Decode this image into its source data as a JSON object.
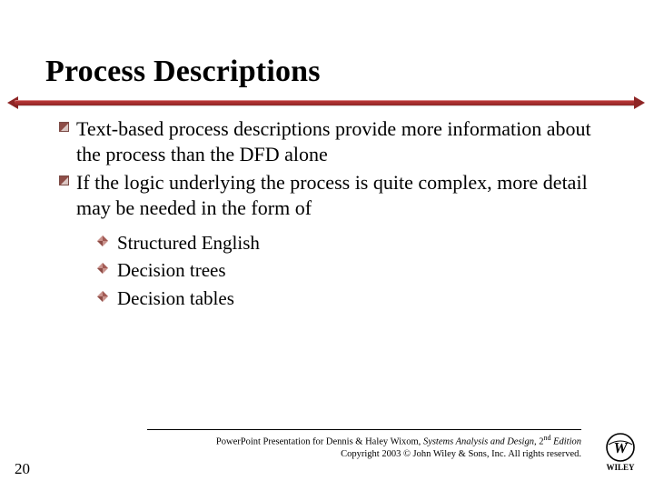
{
  "slide": {
    "title": "Process Descriptions",
    "bullets_level1": [
      "Text-based process descriptions provide more information about the process than the DFD alone",
      "If the logic underlying the process is quite complex, more detail may be needed in the form of"
    ],
    "bullets_level2": [
      "Structured English",
      "Decision trees",
      "Decision tables"
    ],
    "footer": {
      "line1_prefix": "PowerPoint Presentation for Dennis & Haley Wixom, ",
      "book_title": "Systems Analysis and Design, ",
      "edition_num": "2",
      "edition_ord": "nd",
      "edition_suffix": " Edition",
      "line2": "Copyright 2003 © John Wiley & Sons, Inc.  All rights reserved."
    },
    "page_number": "20",
    "publisher": "WILEY"
  },
  "colors": {
    "accent_red": "#8e2525",
    "bullet1": "#8e4d47",
    "bullet2": "#a85a54"
  }
}
